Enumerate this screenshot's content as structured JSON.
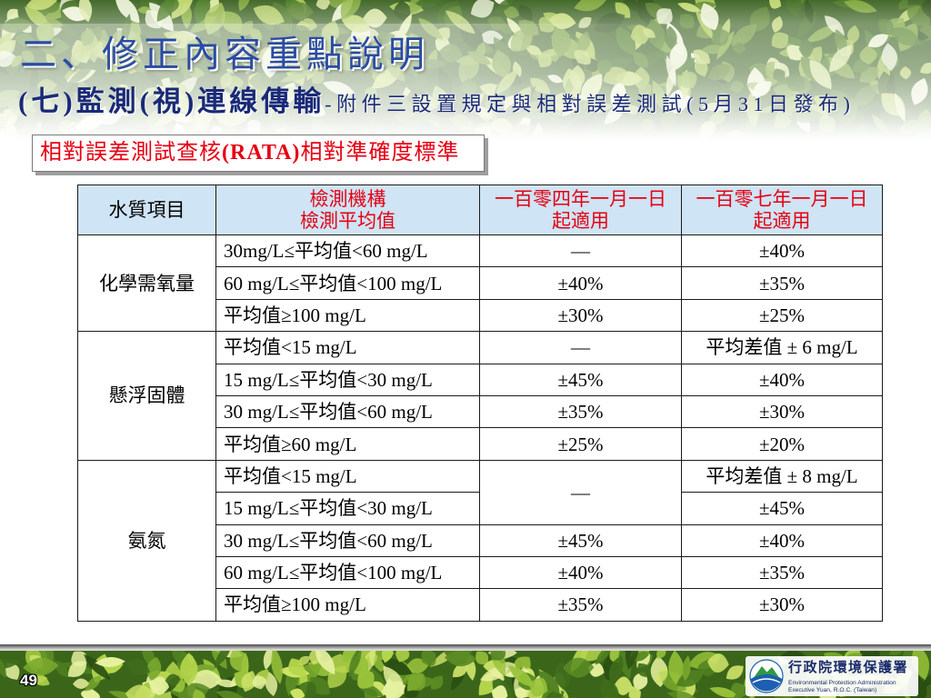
{
  "slide": {
    "title": "二、修正內容重點說明",
    "subtitle_main": "(七)監測(視)連線傳輸",
    "subtitle_detail": "-附件三設置規定與相對誤差測試(5月31日發布)",
    "section_label": {
      "part1": "相對誤差測試查核",
      "part2": "(RATA)",
      "part3": "相對準確度標準"
    },
    "page_number": "49"
  },
  "table": {
    "headers": {
      "item": "水質項目",
      "method_line1": "檢測機構",
      "method_line2": "檢測平均值",
      "col104_line1": "一百零四年一月一日",
      "col104_line2": "起適用",
      "col107_line1": "一百零七年一月一日",
      "col107_line2": "起適用"
    },
    "groups": [
      {
        "name": "化學需氧量",
        "rows": [
          {
            "range": "30mg/L≤平均值<60 mg/L",
            "y104": "—",
            "y107": "±40%"
          },
          {
            "range": "60 mg/L≤平均值<100 mg/L",
            "y104": "±40%",
            "y107": "±35%"
          },
          {
            "range": "平均值≥100 mg/L",
            "y104": "±30%",
            "y107": "±25%"
          }
        ]
      },
      {
        "name": "懸浮固體",
        "rows": [
          {
            "range": "平均值<15 mg/L",
            "y104": "—",
            "y107": "平均差值 ± 6 mg/L"
          },
          {
            "range": "15 mg/L≤平均值<30 mg/L",
            "y104": "±45%",
            "y107": "±40%"
          },
          {
            "range": "30 mg/L≤平均值<60 mg/L",
            "y104": "±35%",
            "y107": "±30%"
          },
          {
            "range": "平均值≥60 mg/L",
            "y104": "±25%",
            "y107": "±20%"
          }
        ]
      },
      {
        "name": "氨氮",
        "rows": [
          {
            "range": "平均值<15 mg/L",
            "y104": "—",
            "y107": "平均差值 ± 8 mg/L"
          },
          {
            "range": "15 mg/L≤平均值<30 mg/L",
            "y107": "±45%"
          },
          {
            "range": "30 mg/L≤平均值<60 mg/L",
            "y104": "±45%",
            "y107": "±40%"
          },
          {
            "range": "60 mg/L≤平均值<100 mg/L",
            "y104": "±40%",
            "y107": "±35%"
          },
          {
            "range": "平均值≥100 mg/L",
            "y104": "±35%",
            "y107": "±30%"
          }
        ]
      }
    ]
  },
  "logo": {
    "name_zh": "行政院環境保護署",
    "name_en_line1": "Environmental Protection Administration",
    "name_en_line2": "Executive Yuan, R.O.C. (Taiwan)"
  },
  "icons": {
    "logo": "epa-logo-icon"
  },
  "colors": {
    "title_blue": "#2a4ca3",
    "subtitle_navy": "#1a2a78",
    "accent_red": "#e60012",
    "header_bg": "#cfe4f5",
    "logo_navy": "#1b2b6b"
  }
}
